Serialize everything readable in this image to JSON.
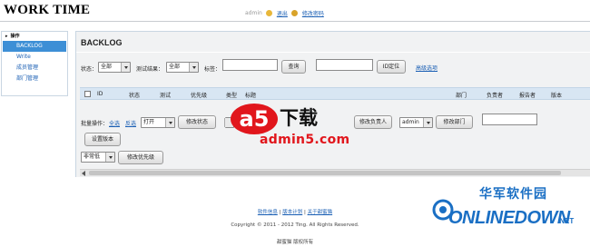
{
  "header": {
    "logo": "WORK TIME",
    "user": "admin",
    "logout": "退出",
    "change_password": "修改密码"
  },
  "sidebar": {
    "head": "操作",
    "items": [
      {
        "label": "BACKLOG"
      },
      {
        "label": "Write"
      },
      {
        "label": "成员管理"
      },
      {
        "label": "部门管理"
      }
    ]
  },
  "main": {
    "title": "BACKLOG",
    "filters": {
      "status_label": "状态：",
      "status_value": "全部",
      "result_label": "测试结果：",
      "result_value": "全部",
      "tag_label": "标签：",
      "tag_value": "",
      "query_button": "查询",
      "id_value": "",
      "id_button": "ID定位",
      "advanced_link": "高级选项"
    },
    "table_headers": {
      "id": "ID",
      "status": "状态",
      "test": "测试",
      "priority": "优先级",
      "type": "类型",
      "title": "标题",
      "dept": "部门",
      "owner": "负责者",
      "reporter": "报告者",
      "version": "版本"
    },
    "batch": {
      "label": "批量操作：",
      "select_all": "全选",
      "invert": "反选",
      "status_value": "打开",
      "modify_status": "修改状态",
      "type_value": "",
      "modify_owner": "修改负责人",
      "owner_value": "admin",
      "modify_dept": "修改部门",
      "version_value": "",
      "set_version": "设置版本",
      "priority_value": "非常低",
      "modify_priority": "修改优先级"
    }
  },
  "footer": {
    "links": [
      "软件信息",
      "版本计划",
      "关于甜蜜猫"
    ],
    "separator": "|",
    "copyright": "Copyright © 2011 - 2012 Ting. All Rights Reserved.",
    "rights": "甜蜜猫 版权所有"
  },
  "watermarks": {
    "a5_mark": "a5",
    "a5_label": "下载",
    "a5_domain": "admin5.com",
    "od_cn": "华军软件园",
    "od_en": "ONLINEDOWN",
    "od_net": ".NET"
  },
  "colors": {
    "accent": "#3d8fd6",
    "link": "#1a5fb4",
    "table_header": "#d8e6f3",
    "panel": "#f1f2f3",
    "a5_red": "#e1161c",
    "od_blue": "#1a6fc4"
  },
  "icons": [
    "user-icon",
    "key-icon",
    "chevron-down-icon",
    "scroll-left-icon"
  ]
}
